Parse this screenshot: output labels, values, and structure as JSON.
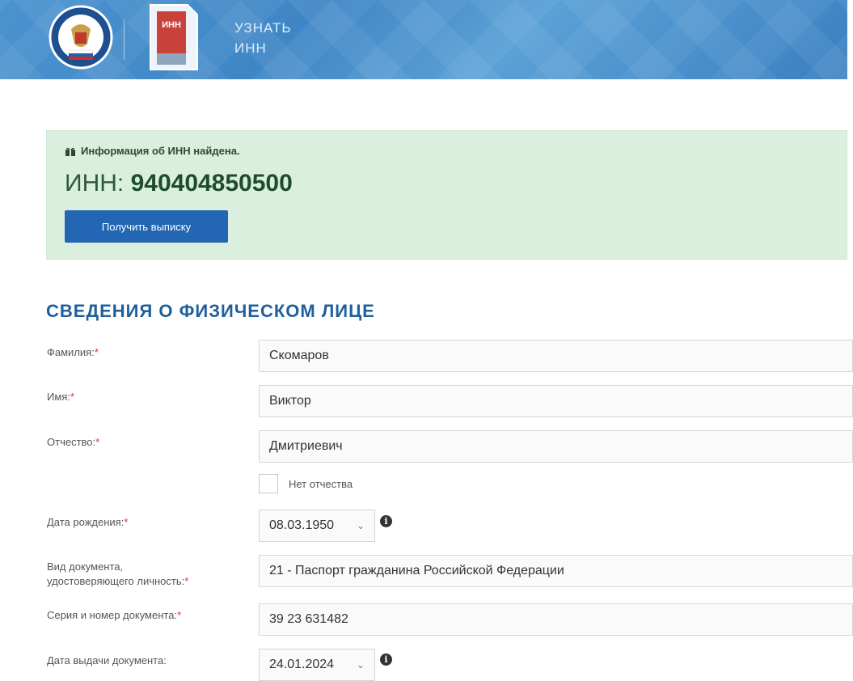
{
  "header": {
    "title_line1": "УЗНАТЬ",
    "title_line2": "ИНН",
    "doc_icon_text": "ИНН"
  },
  "alert": {
    "message": "Информация об ИНН найдена.",
    "inn_label": "ИНН:",
    "inn_value": "940404850500",
    "button_label": "Получить выписку"
  },
  "section_title": "СВЕДЕНИЯ О ФИЗИЧЕСКОМ ЛИЦЕ",
  "form": {
    "surname": {
      "label": "Фамилия:",
      "value": "Скомаров"
    },
    "name": {
      "label": "Имя:",
      "value": "Виктор"
    },
    "patronymic": {
      "label": "Отчество:",
      "value": "Дмитриевич"
    },
    "no_patronymic": {
      "label": "Нет отчества"
    },
    "birth_date": {
      "label": "Дата рождения:",
      "value": "08.03.1950"
    },
    "doc_type": {
      "label_line1": "Вид документа,",
      "label_line2": "удостоверяющего личность:",
      "value": "21 - Паспорт гражданина Российской Федерации"
    },
    "doc_number": {
      "label": "Серия и номер документа:",
      "value": "39 23 631482"
    },
    "issue_date": {
      "label": "Дата выдачи документа:",
      "value": "24.01.2024"
    },
    "required_mark": "*"
  },
  "colors": {
    "header_blue": "#4a93cf",
    "alert_green": "#dbefdf",
    "button_blue": "#2366b4",
    "title_blue": "#1e5f9c",
    "required_red": "#d9342b"
  },
  "icons": [
    "fns-emblem-icon",
    "inn-document-icon",
    "gift-icon",
    "chevron-down-icon",
    "info-icon"
  ]
}
